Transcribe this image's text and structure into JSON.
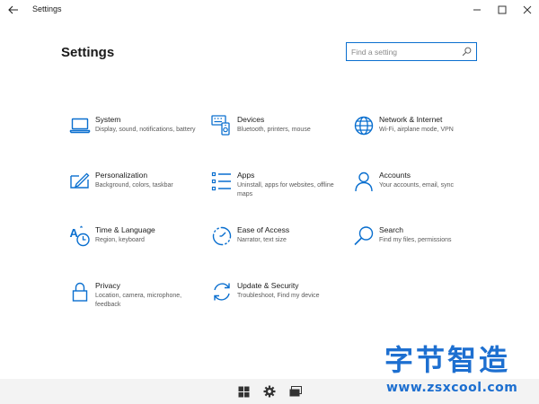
{
  "window": {
    "title": "Settings",
    "accent_color": "#0a6fcf",
    "back_icon": "arrow-left-icon",
    "controls": [
      "minimize-icon",
      "maximize-icon",
      "close-icon"
    ]
  },
  "header": {
    "title": "Settings"
  },
  "search": {
    "placeholder": "Find a setting",
    "value": ""
  },
  "tiles": [
    {
      "name": "System",
      "desc": "Display, sound, notifications, battery",
      "icon": "laptop-icon"
    },
    {
      "name": "Devices",
      "desc": "Bluetooth, printers, mouse",
      "icon": "keyboard-speaker-icon"
    },
    {
      "name": "Network & Internet",
      "desc": "Wi-Fi, airplane mode, VPN",
      "icon": "globe-icon"
    },
    {
      "name": "Personalization",
      "desc": "Background, colors, taskbar",
      "icon": "pen-screen-icon"
    },
    {
      "name": "Apps",
      "desc": "Uninstall, apps for websites, offline maps",
      "icon": "apps-list-icon"
    },
    {
      "name": "Accounts",
      "desc": "Your accounts, email, sync",
      "icon": "person-icon"
    },
    {
      "name": "Time & Language",
      "desc": "Region, keyboard",
      "icon": "time-language-icon"
    },
    {
      "name": "Ease of Access",
      "desc": "Narrator, text size",
      "icon": "ease-of-access-icon"
    },
    {
      "name": "Search",
      "desc": "Find my files, permissions",
      "icon": "magnifier-icon"
    },
    {
      "name": "Privacy",
      "desc": "Location, camera, microphone, feedback",
      "icon": "lock-icon"
    },
    {
      "name": "Update & Security",
      "desc": "Troubleshoot, Find my device",
      "icon": "sync-arrows-icon"
    }
  ],
  "taskbar": {
    "items": [
      "windows-logo-icon",
      "gear-icon",
      "task-view-icon"
    ]
  },
  "watermark": {
    "chinese": "字节智造",
    "url": "www.zsxcool.com"
  }
}
